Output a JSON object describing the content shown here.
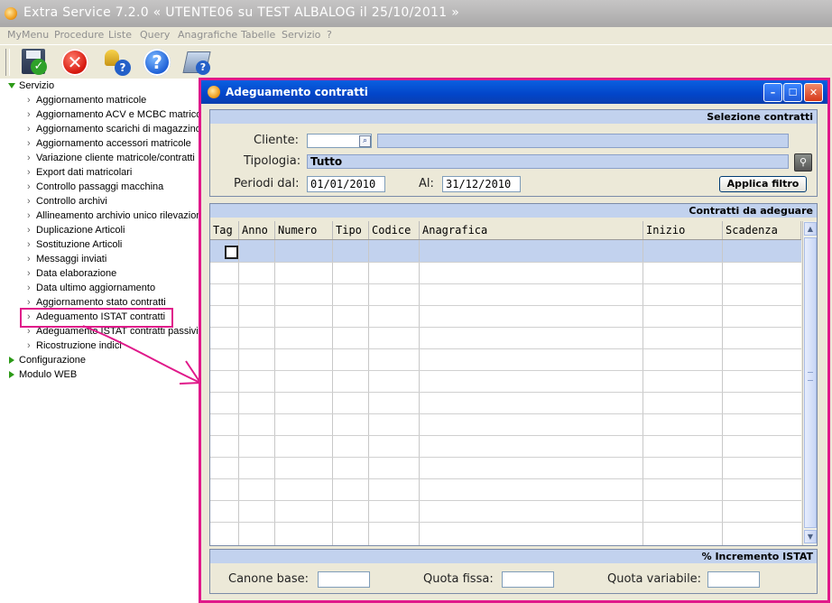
{
  "app": {
    "title": "Extra Service 7.2.0  « UTENTE06 su TEST ALBALOG il 25/10/2011 »"
  },
  "menu": [
    "MyMenu",
    "Procedure",
    "Liste",
    "Query",
    "Anagrafiche",
    "Tabelle",
    "Servizio",
    "?"
  ],
  "toolbar": {
    "icons": [
      "save-confirm-icon",
      "cancel-icon",
      "user-help-icon",
      "help-icon",
      "document-help-icon"
    ]
  },
  "tree": {
    "root": "Servizio",
    "items": [
      "Aggiornamento matricole",
      "Aggiornamento ACV e MCBC matricole",
      "Aggiornamento scarichi di magazzino matricole",
      "Aggiornamento accessori matricole",
      "Variazione cliente matricole/contratti",
      "Export dati matricolari",
      "Controllo passaggi macchina",
      "Controllo archivi",
      "Allineamento archivio unico rilevazioni",
      "Duplicazione Articoli",
      "Sostituzione Articoli",
      "Messaggi inviati",
      "Data elaborazione",
      "Data ultimo aggiornamento",
      "Aggiornamento stato contratti",
      "Adeguamento ISTAT contratti",
      "Adeguamento ISTAT contratti passivi",
      "Ricostruzione indici"
    ],
    "highlighted_index": 15,
    "others": [
      "Configurazione",
      "Modulo WEB"
    ]
  },
  "window": {
    "title": "Adeguamento contratti",
    "selection": {
      "header": "Selezione contratti",
      "cliente_label": "Cliente:",
      "cliente_value": "",
      "tipologia_label": "Tipologia:",
      "tipologia_value": "Tutto",
      "periodi_label": "Periodi dal:",
      "dal_value": "01/01/2010",
      "al_label": "Al:",
      "al_value": "31/12/2010",
      "apply_button": "Applica filtro"
    },
    "contracts": {
      "header": "Contratti da adeguare",
      "columns": [
        "Tag",
        "Anno",
        "Numero",
        "Tipo",
        "Codice",
        "Anagrafica",
        "Inizio",
        "Scadenza"
      ]
    },
    "istat": {
      "header": "% Incremento ISTAT",
      "canone_label": "Canone base:",
      "quota_fissa_label": "Quota fissa:",
      "quota_variabile_label": "Quota variabile:"
    }
  }
}
